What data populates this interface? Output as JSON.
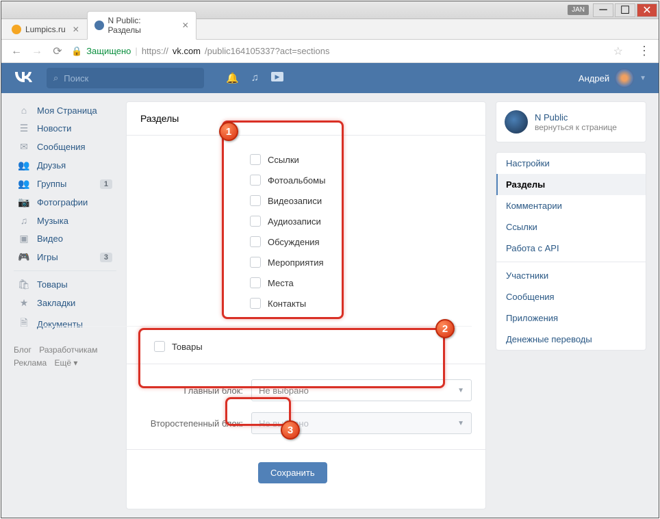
{
  "window": {
    "badge": "JAN"
  },
  "tabs": [
    {
      "title": "Lumpics.ru",
      "favicon_color": "#f5a623"
    },
    {
      "title": "N Public: Разделы",
      "favicon_color": "#4a76a8"
    }
  ],
  "addressBar": {
    "secure": "Защищено",
    "url_prefix": "https://",
    "url_host": "vk.com",
    "url_path": "/public164105337?act=sections"
  },
  "header": {
    "logo": "VK",
    "search_placeholder": "Поиск",
    "username": "Андрей"
  },
  "leftNav": {
    "items": [
      {
        "icon": "home",
        "label": "Моя Страница"
      },
      {
        "icon": "news",
        "label": "Новости"
      },
      {
        "icon": "msg",
        "label": "Сообщения"
      },
      {
        "icon": "friends",
        "label": "Друзья"
      },
      {
        "icon": "groups",
        "label": "Группы",
        "badge": "1"
      },
      {
        "icon": "photo",
        "label": "Фотографии"
      },
      {
        "icon": "music",
        "label": "Музыка"
      },
      {
        "icon": "video",
        "label": "Видео"
      },
      {
        "icon": "games",
        "label": "Игры",
        "badge": "3"
      }
    ],
    "items2": [
      {
        "icon": "market",
        "label": "Товары"
      },
      {
        "icon": "bookmark",
        "label": "Закладки"
      },
      {
        "icon": "docs",
        "label": "Документы"
      }
    ],
    "footer": [
      "Блог",
      "Разработчикам",
      "Реклама",
      "Ещё ▾"
    ]
  },
  "main": {
    "title": "Разделы",
    "sections": [
      "Ссылки",
      "Фотоальбомы",
      "Видеозаписи",
      "Аудиозаписи",
      "Обсуждения",
      "Мероприятия",
      "Места",
      "Контакты"
    ],
    "sections_extra": [
      "Товары"
    ],
    "main_block_label": "Главный блок:",
    "main_block_value": "Не выбрано",
    "secondary_block_label": "Второстепенный блок:",
    "secondary_block_value": "Не выбрано",
    "save_label": "Сохранить"
  },
  "right": {
    "group_name": "N Public",
    "group_sub": "вернуться к странице",
    "menu": [
      {
        "label": "Настройки"
      },
      {
        "label": "Разделы",
        "active": true
      },
      {
        "label": "Комментарии"
      },
      {
        "label": "Ссылки"
      },
      {
        "label": "Работа с API"
      }
    ],
    "menu2": [
      {
        "label": "Участники"
      },
      {
        "label": "Сообщения"
      },
      {
        "label": "Приложения"
      },
      {
        "label": "Денежные переводы"
      }
    ]
  },
  "annotations": {
    "one": "1",
    "two": "2",
    "three": "3"
  }
}
